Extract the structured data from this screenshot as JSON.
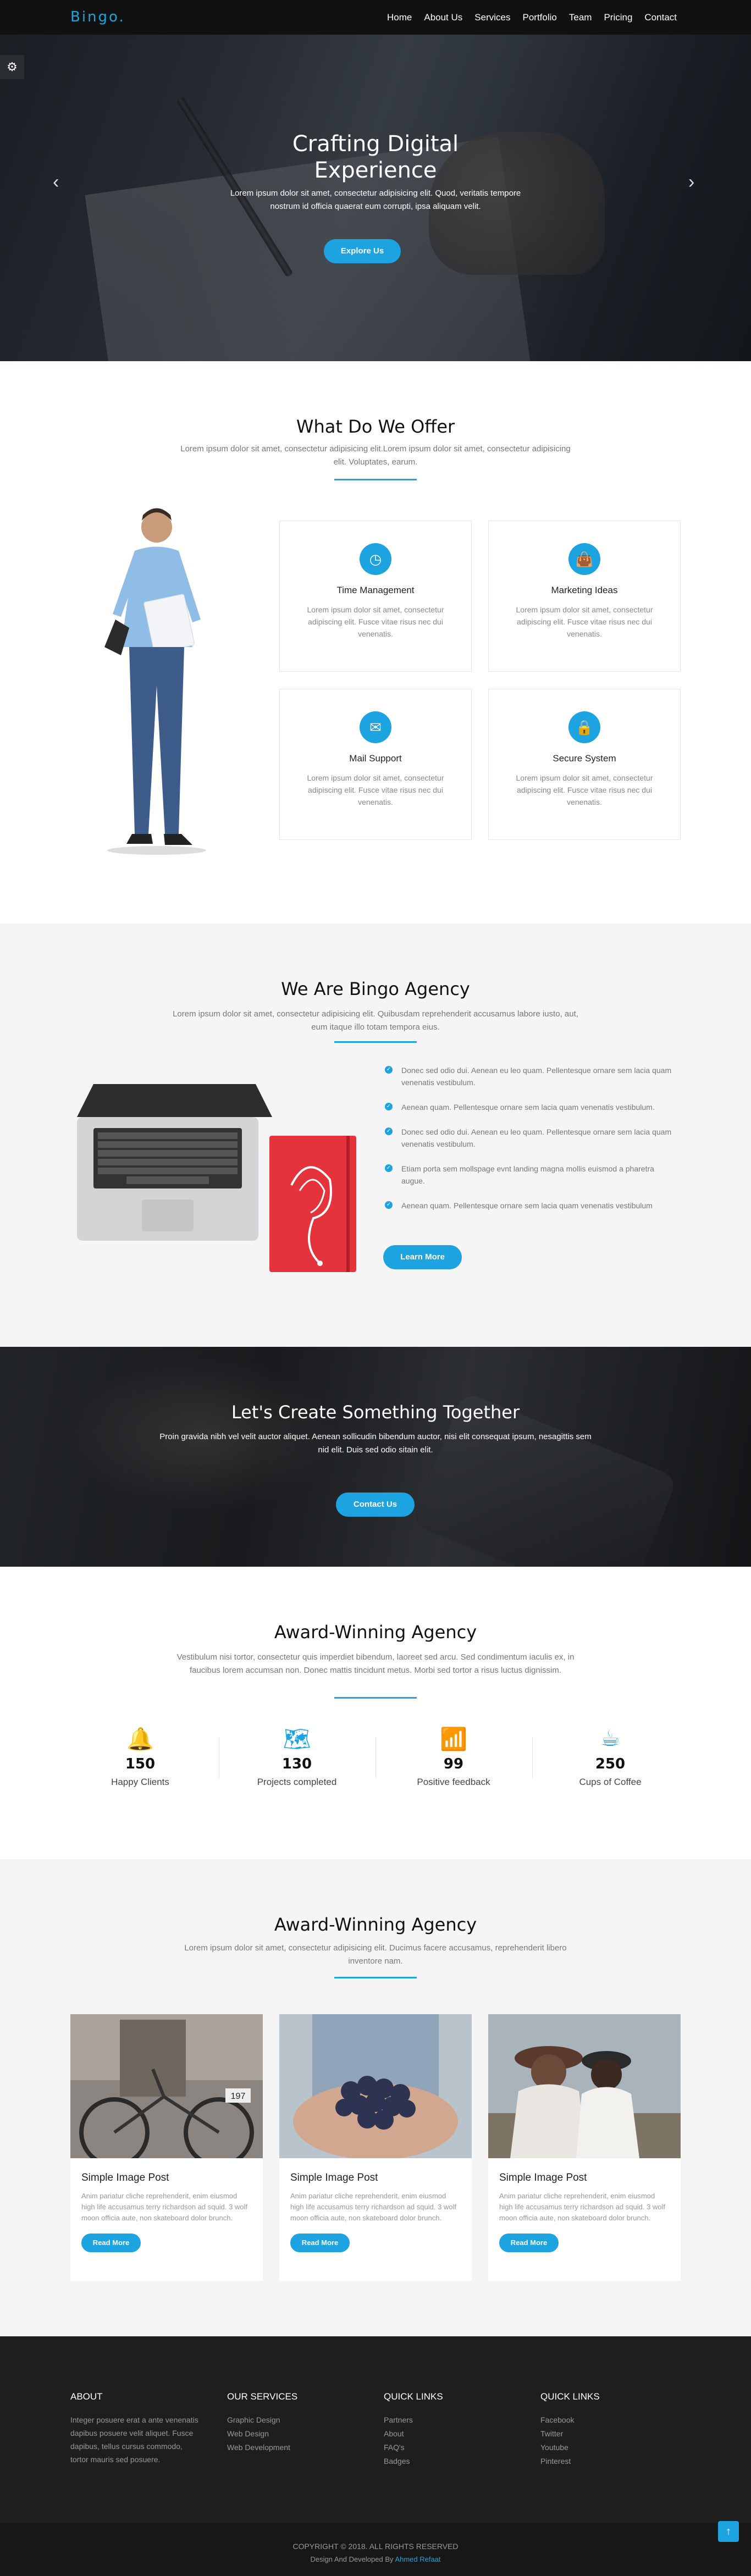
{
  "nav": {
    "logo": "Bingo.",
    "links": [
      "Home",
      "About Us",
      "Services",
      "Portfolio",
      "Team",
      "Pricing",
      "Contact"
    ]
  },
  "hero": {
    "title_line1": "Crafting Digital",
    "title_line2": "Experience",
    "subtitle": "Lorem ipsum dolor sit amet, consectetur adipisicing elit. Quod, veritatis tempore nostrum id officia quaerat eum corrupti, ipsa aliquam velit.",
    "button": "Explore Us"
  },
  "offer": {
    "title": "What Do We Offer",
    "subtitle": "Lorem ipsum dolor sit amet, consectetur adipisicing elit.Lorem ipsum dolor sit amet, consectetur adipisicing elit. Voluptates, earum.",
    "cards": [
      {
        "icon": "clock-icon",
        "title": "Time Management",
        "text": "Lorem ipsum dolor sit amet, consectetur adipiscing elit. Fusce vitae risus nec dui venenatis."
      },
      {
        "icon": "shopping-bag-icon",
        "title": "Marketing Ideas",
        "text": "Lorem ipsum dolor sit amet, consectetur adipiscing elit. Fusce vitae risus nec dui venenatis."
      },
      {
        "icon": "envelope-icon",
        "title": "Mail Support",
        "text": "Lorem ipsum dolor sit amet, consectetur adipiscing elit. Fusce vitae risus nec dui venenatis."
      },
      {
        "icon": "lock-icon",
        "title": "Secure System",
        "text": "Lorem ipsum dolor sit amet, consectetur adipiscing elit. Fusce vitae risus nec dui venenatis."
      }
    ]
  },
  "agency": {
    "title": "We Are Bingo Agency",
    "subtitle": "Lorem ipsum dolor sit amet, consectetur adipisicing elit. Quibusdam reprehenderit accusamus labore iusto, aut, eum itaque illo totam tempora eius.",
    "items": [
      "Donec sed odio dui. Aenean eu leo quam. Pellentesque ornare sem lacia quam venenatis vestibulum.",
      "Aenean quam. Pellentesque ornare sem lacia quam venenatis vestibulum.",
      "Donec sed odio dui. Aenean eu leo quam. Pellentesque ornare sem lacia quam venenatis vestibulum.",
      "Etiam porta sem mollspage evnt landing magna mollis euismod a pharetra augue.",
      "Aenean quam. Pellentesque ornare sem lacia quam venenatis vestibulum"
    ],
    "button": "Learn More"
  },
  "cta": {
    "title": "Let's Create Something Together",
    "subtitle": "Proin gravida nibh vel velit auctor aliquet. Aenean sollicudin bibendum auctor, nisi elit consequat ipsum, nesagittis sem nid elit. Duis sed odio sitain elit.",
    "button": "Contact Us"
  },
  "stats": {
    "title": "Award-Winning Agency",
    "subtitle": "Vestibulum nisi tortor, consectetur quis imperdiet bibendum, laoreet sed arcu. Sed condimentum iaculis ex, in faucibus lorem accumsan non. Donec mattis tincidunt metus. Morbi sed tortor a risus luctus dignissim.",
    "items": [
      {
        "icon": "bell-icon",
        "value": "150",
        "label": "Happy Clients"
      },
      {
        "icon": "map-icon",
        "value": "130",
        "label": "Projects completed"
      },
      {
        "icon": "rss-icon",
        "value": "99",
        "label": "Positive feedback"
      },
      {
        "icon": "coffee-icon",
        "value": "250",
        "label": "Cups of Coffee"
      }
    ]
  },
  "blog": {
    "title": "Award-Winning Agency",
    "subtitle": "Lorem ipsum dolor sit amet, consectetur adipisicing elit. Ducimus facere accusamus, reprehenderit libero inventore nam.",
    "posts": [
      {
        "title": "Simple Image Post",
        "text": "Anim pariatur cliche reprehenderit, enim eiusmod high life accusamus terry richardson ad squid. 3 wolf moon officia aute, non skateboard dolor brunch.",
        "button": "Read More"
      },
      {
        "title": "Simple Image Post",
        "text": "Anim pariatur cliche reprehenderit, enim eiusmod high life accusamus terry richardson ad squid. 3 wolf moon officia aute, non skateboard dolor brunch.",
        "button": "Read More"
      },
      {
        "title": "Simple Image Post",
        "text": "Anim pariatur cliche reprehenderit, enim eiusmod high life accusamus terry richardson ad squid. 3 wolf moon officia aute, non skateboard dolor brunch.",
        "button": "Read More"
      }
    ],
    "bike_tag": "197"
  },
  "footer": {
    "about_title": "ABOUT",
    "about_text": "Integer posuere erat a ante venenatis dapibus posuere velit aliquet. Fusce dapibus, tellus cursus commodo, tortor mauris sed posuere.",
    "services_title": "OUR SERVICES",
    "services": [
      "Graphic Design",
      "Web Design",
      "Web Development"
    ],
    "links1_title": "QUICK LINKS",
    "links1": [
      "Partners",
      "About",
      "FAQ's",
      "Badges"
    ],
    "links2_title": "QUICK LINKS",
    "links2": [
      "Facebook",
      "Twitter",
      "Youtube",
      "Pinterest"
    ],
    "copyright": "COPYRIGHT © 2018. ALL RIGHTS RESERVED",
    "developed_prefix": "Design And Developed By",
    "developer": "Ahmed Refaat"
  },
  "colors": {
    "accent": "#1ca3e0",
    "dark": "#111111",
    "light_bg": "#f5f5f5",
    "footer_bg": "#1e1e1e"
  }
}
